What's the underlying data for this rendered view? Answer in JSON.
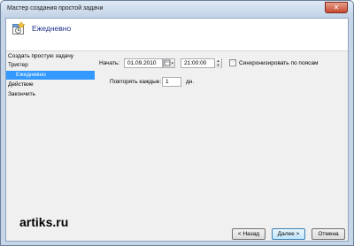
{
  "window": {
    "title": "Мастер создания простой задачи",
    "close_glyph": "✕"
  },
  "header": {
    "title": "Ежедневно",
    "icon": "calendar-icon"
  },
  "sidebar": {
    "items": [
      {
        "label": "Создать простую задачу",
        "selected": false
      },
      {
        "label": "Триггер",
        "selected": false
      },
      {
        "label": "Ежедневно",
        "selected": true
      },
      {
        "label": "Действие",
        "selected": false
      },
      {
        "label": "Закончить",
        "selected": false
      }
    ]
  },
  "form": {
    "start_label": "Начать:",
    "start_date": "01.09.2010",
    "start_time": "21:00:00",
    "sync_timezones_label": "Синхронизировать по поясам",
    "sync_timezones_checked": false,
    "repeat_label": "Повторять каждые:",
    "repeat_value": "1",
    "repeat_unit": "дн."
  },
  "watermark": "artiks.ru",
  "buttons": {
    "back": "< Назад",
    "next": "Далее >",
    "cancel": "Отмена"
  },
  "colors": {
    "selection": "#3399ff",
    "header_title": "#1e3287",
    "frame": "#c6d6e8"
  }
}
